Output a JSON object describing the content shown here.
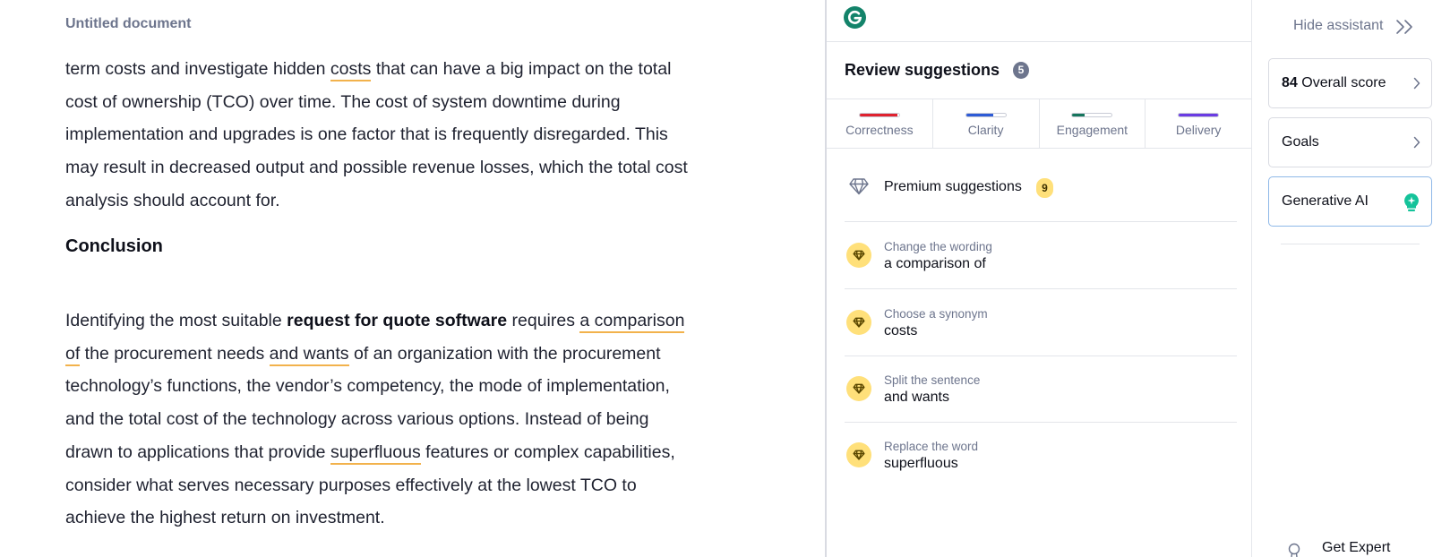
{
  "editor": {
    "title": "Untitled document",
    "para1": {
      "a": "term costs and investigate hidden ",
      "costs": "costs",
      "b": " that can have a big impact on the total cost of ownership (TCO) over time. The cost of system downtime during implementation and upgrades is one factor that is frequently disregarded. This may result in decreased output and possible revenue losses, which the total cost analysis should account for."
    },
    "heading": "Conclusion",
    "para2": {
      "a": "Identifying the most suitable ",
      "bold": "request for quote software",
      "b": " requires ",
      "comparison": "a comparison of",
      "c": " the procurement needs ",
      "wants": "and wants",
      "d": " of an organization with the procurement technology’s functions, the vendor’s competency, the mode of implementation, and the total cost of the technology across various options. Instead of being drawn to applications that provide ",
      "superfluous": "superfluous",
      "e": " features or complex capabilities, consider what serves necessary purposes effectively at the lowest TCO to achieve the highest return on investment."
    }
  },
  "panel": {
    "logo_icon": "grammarly-logo-icon",
    "title": "Review suggestions",
    "count": "5",
    "tabs": [
      {
        "label": "Correctness",
        "color": "#e0212e",
        "level": 0.95
      },
      {
        "label": "Clarity",
        "color": "#2d5bd6",
        "level": 0.7
      },
      {
        "label": "Engagement",
        "color": "#15755c",
        "level": 0.3
      },
      {
        "label": "Delivery",
        "color": "#6a3be3",
        "level": 1.0
      }
    ],
    "premium": {
      "icon": "diamond-icon",
      "label": "Premium suggestions",
      "count": "9"
    },
    "suggestions": [
      {
        "type": "Change the wording",
        "text": "a comparison of"
      },
      {
        "type": "Choose a synonym",
        "text": "costs"
      },
      {
        "type": "Split the sentence",
        "text": "and wants"
      },
      {
        "type": "Replace the word",
        "text": "superfluous"
      }
    ]
  },
  "rail": {
    "hide_label": "Hide assistant",
    "score_value": "84",
    "score_label": "Overall score",
    "goals_label": "Goals",
    "genai_label": "Generative AI",
    "expert_label": "Get Expert"
  }
}
